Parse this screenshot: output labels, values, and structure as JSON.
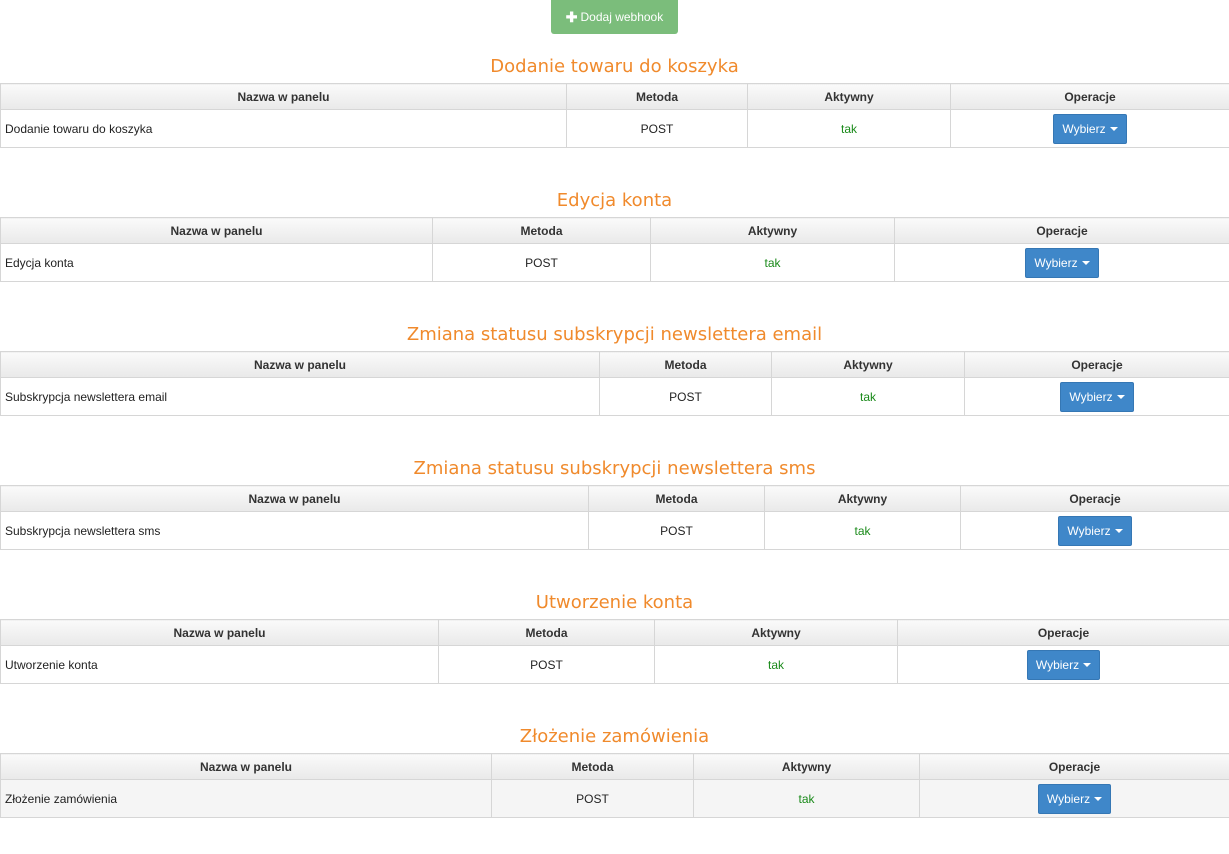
{
  "toolbar": {
    "add_webhook_label": "Dodaj webhook"
  },
  "columns": {
    "name": "Nazwa w panelu",
    "method": "Metoda",
    "active": "Aktywny",
    "ops": "Operacje"
  },
  "sections": [
    {
      "title": "Dodanie towaru do koszyka",
      "row": {
        "name": "Dodanie towaru do koszyka",
        "method": "POST",
        "active": "tak",
        "button": "Wybierz"
      }
    },
    {
      "title": "Edycja konta",
      "row": {
        "name": "Edycja konta",
        "method": "POST",
        "active": "tak",
        "button": "Wybierz"
      }
    },
    {
      "title": "Zmiana statusu subskrypcji newslettera email",
      "row": {
        "name": "Subskrypcja newslettera email",
        "method": "POST",
        "active": "tak",
        "button": "Wybierz"
      }
    },
    {
      "title": "Zmiana statusu subskrypcji newslettera sms",
      "row": {
        "name": "Subskrypcja newslettera sms",
        "method": "POST",
        "active": "tak",
        "button": "Wybierz"
      }
    },
    {
      "title": "Utworzenie konta",
      "row": {
        "name": "Utworzenie konta",
        "method": "POST",
        "active": "tak",
        "button": "Wybierz"
      }
    },
    {
      "title": "Złożenie zamówienia",
      "row": {
        "name": "Złożenie zamówienia",
        "method": "POST",
        "active": "tak",
        "button": "Wybierz"
      }
    }
  ],
  "colors": {
    "section_title": "#f08a2c",
    "add_button": "#7bbd7b",
    "select_button": "#3f87c9",
    "active_text": "#1a8a1a"
  }
}
